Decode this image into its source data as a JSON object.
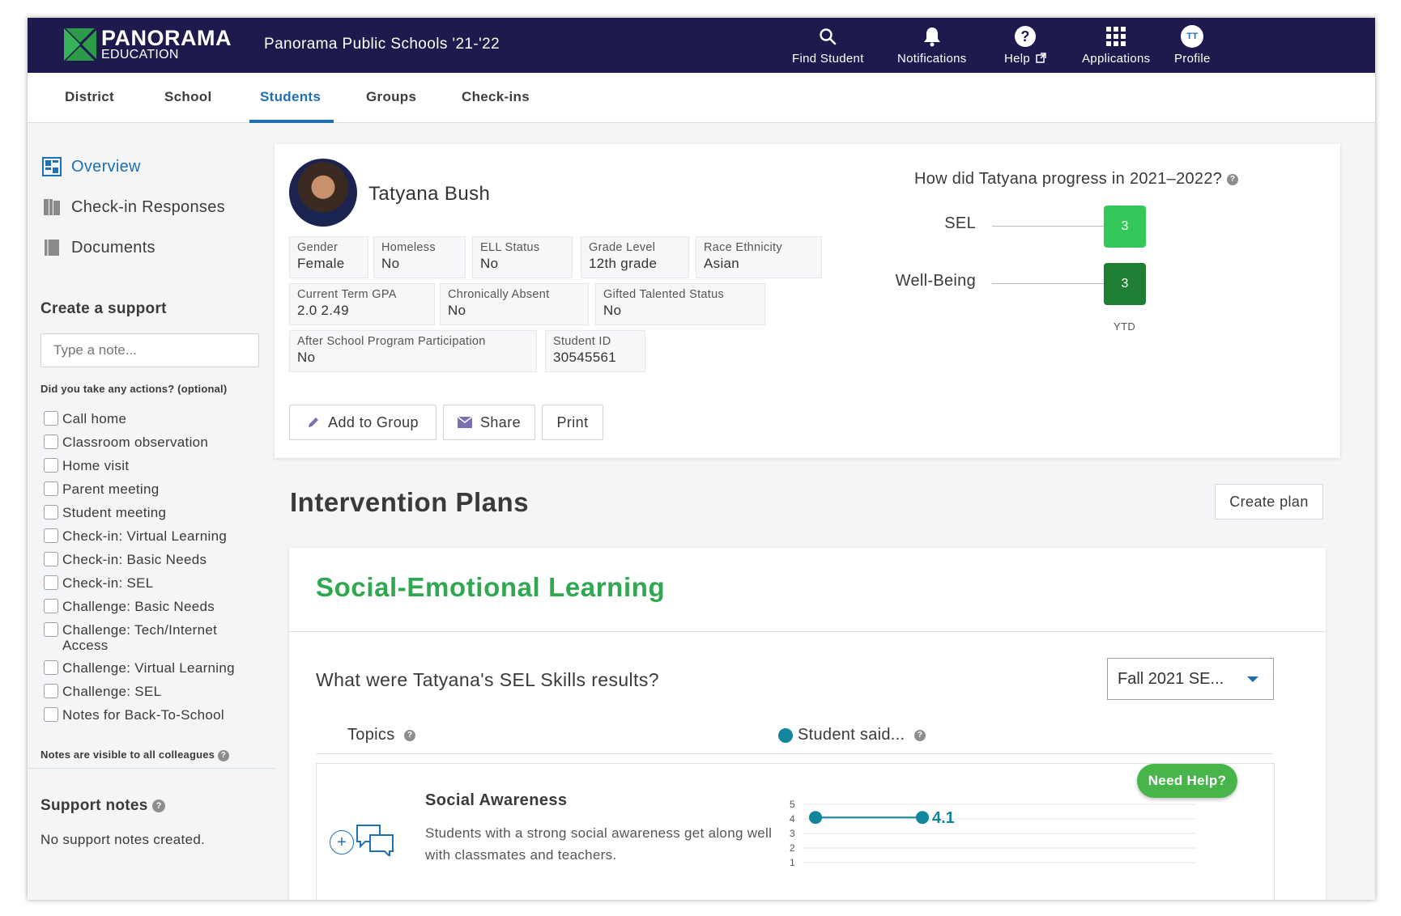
{
  "header": {
    "logo_main": "PANORAMA",
    "logo_sub": "EDUCATION",
    "org_title": "Panorama Public Schools '21-'22",
    "nav": [
      {
        "label": "Find Student",
        "icon": "search-icon"
      },
      {
        "label": "Notifications",
        "icon": "bell-icon"
      },
      {
        "label": "Help",
        "icon": "help-icon"
      },
      {
        "label": "Applications",
        "icon": "grid-icon"
      },
      {
        "label": "Profile",
        "icon": "avatar-icon",
        "initials": "TT"
      }
    ]
  },
  "tabs": [
    {
      "label": "District",
      "active": false
    },
    {
      "label": "School",
      "active": false
    },
    {
      "label": "Students",
      "active": true
    },
    {
      "label": "Groups",
      "active": false
    },
    {
      "label": "Check-ins",
      "active": false
    }
  ],
  "sidebar": {
    "links": [
      {
        "label": "Overview",
        "icon": "overview-icon",
        "active": true
      },
      {
        "label": "Check-in Responses",
        "icon": "book-icon",
        "active": false
      },
      {
        "label": "Documents",
        "icon": "document-icon",
        "active": false
      }
    ],
    "create_support_title": "Create a support",
    "note_placeholder": "Type a note...",
    "actions_label": "Did you take any actions? (optional)",
    "actions": [
      "Call home",
      "Classroom observation",
      "Home visit",
      "Parent meeting",
      "Student meeting",
      "Check-in: Virtual Learning",
      "Check-in: Basic Needs",
      "Check-in: SEL",
      "Challenge: Basic Needs",
      "Challenge: Tech/Internet Access",
      "Challenge: Virtual Learning",
      "Challenge: SEL",
      "Notes for Back-To-School"
    ],
    "visibility_note": "Notes are visible to all colleagues",
    "support_notes_title": "Support notes",
    "support_notes_empty": "No support notes created."
  },
  "student": {
    "name": "Tatyana Bush",
    "attributes": [
      {
        "key": "Gender",
        "value": "Female"
      },
      {
        "key": "Homeless",
        "value": "No"
      },
      {
        "key": "ELL Status",
        "value": "No"
      },
      {
        "key": "Grade Level",
        "value": "12th grade"
      },
      {
        "key": "Race Ethnicity",
        "value": "Asian"
      },
      {
        "key": "Current Term GPA",
        "value": "2.0 2.49"
      },
      {
        "key": "Chronically Absent",
        "value": "No"
      },
      {
        "key": "Gifted Talented Status",
        "value": "No"
      },
      {
        "key": "After School Program Participation",
        "value": "No"
      },
      {
        "key": "Student ID",
        "value": "30545561"
      }
    ],
    "buttons": {
      "add_to_group": "Add to Group",
      "share": "Share",
      "print": "Print"
    }
  },
  "progress": {
    "title": "How did Tatyana progress in 2021–2022?",
    "rows": [
      {
        "label": "SEL",
        "value": "3",
        "color": "#34c75a"
      },
      {
        "label": "Well-Being",
        "value": "3",
        "color": "#1e7e34"
      }
    ],
    "column_label": "YTD"
  },
  "intervention": {
    "title": "Intervention Plans",
    "create_button": "Create plan"
  },
  "sel": {
    "title": "Social-Emotional Learning",
    "question": "What were Tatyana's SEL Skills results?",
    "dropdown_value": "Fall 2021 SE...",
    "col_topics": "Topics",
    "col_student": "Student said...",
    "topic": {
      "name": "Social Awareness",
      "description": "Students with a strong social awareness get along well with classmates and teachers.",
      "score": "4.1",
      "y_ticks": [
        "5",
        "4",
        "3",
        "2",
        "1"
      ]
    }
  },
  "help_button": "Need Help?",
  "colors": {
    "navy": "#1f1a4d",
    "accent_blue": "#1f6fb5",
    "green": "#2fa84f",
    "teal": "#12869a"
  }
}
